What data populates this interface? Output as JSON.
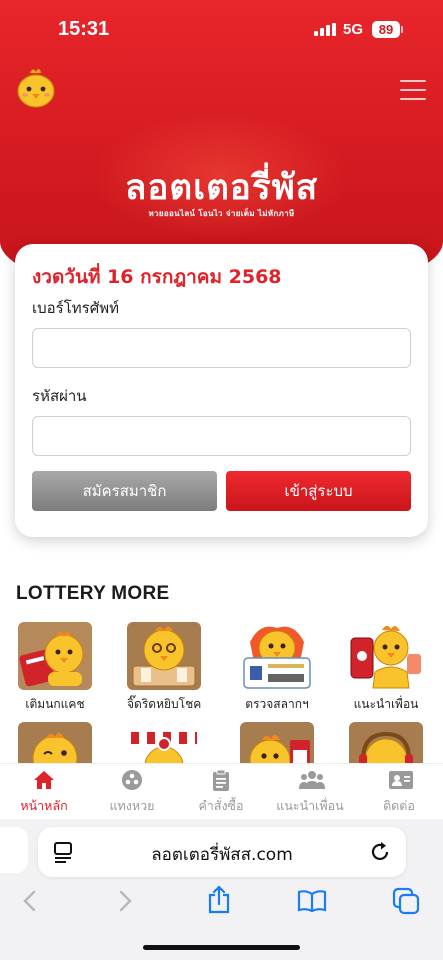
{
  "status": {
    "time": "15:31",
    "network": "5G",
    "battery": "89"
  },
  "header": {
    "brand": "ลอตเตอรี่พัส",
    "tagline": "หวยออนไลน์ โอนไว จ่ายเต็ม ไม่หักภาษี"
  },
  "login": {
    "draw_title": "งวดวันที่ 16 กรกฎาคม 2568",
    "phone_label": "เบอร์โทรศัพท์",
    "phone_value": "",
    "password_label": "รหัสผ่าน",
    "password_value": "",
    "register_label": "สมัครสมาชิก",
    "login_label": "เข้าสู่ระบบ"
  },
  "lottery_more": {
    "title": "LOTTERY MORE",
    "items": [
      {
        "label": "เติมนกแคช",
        "icon": "chick-wallet-icon"
      },
      {
        "label": "จิ๊ดริดหยิบโชค",
        "icon": "chick-scratch-icon"
      },
      {
        "label": "ตรวจสลากฯ",
        "icon": "chick-ticket-icon"
      },
      {
        "label": "แนะนำเพื่อน",
        "icon": "chick-phone-icon"
      },
      {
        "label": "",
        "icon": "chick-wink-icon"
      },
      {
        "label": "",
        "icon": "chick-shop-icon"
      },
      {
        "label": "",
        "icon": "chick-calendar-icon"
      },
      {
        "label": "",
        "icon": "chick-headphones-icon"
      }
    ]
  },
  "bottom_nav": [
    {
      "label": "หน้าหลัก",
      "icon": "home-icon",
      "active": true
    },
    {
      "label": "แทงหวย",
      "icon": "lottery-ball-icon",
      "active": false
    },
    {
      "label": "คำสั่งซื้อ",
      "icon": "clipboard-icon",
      "active": false
    },
    {
      "label": "แนะนำเพื่อน",
      "icon": "users-icon",
      "active": false
    },
    {
      "label": "ติดต่อ",
      "icon": "contact-card-icon",
      "active": false
    }
  ],
  "browser": {
    "url": "ลอตเตอรี่พัสส.com"
  },
  "colors": {
    "brand_red": "#e02229",
    "header_red": "#d31a20",
    "inactive_gray": "#9a9a9a"
  }
}
